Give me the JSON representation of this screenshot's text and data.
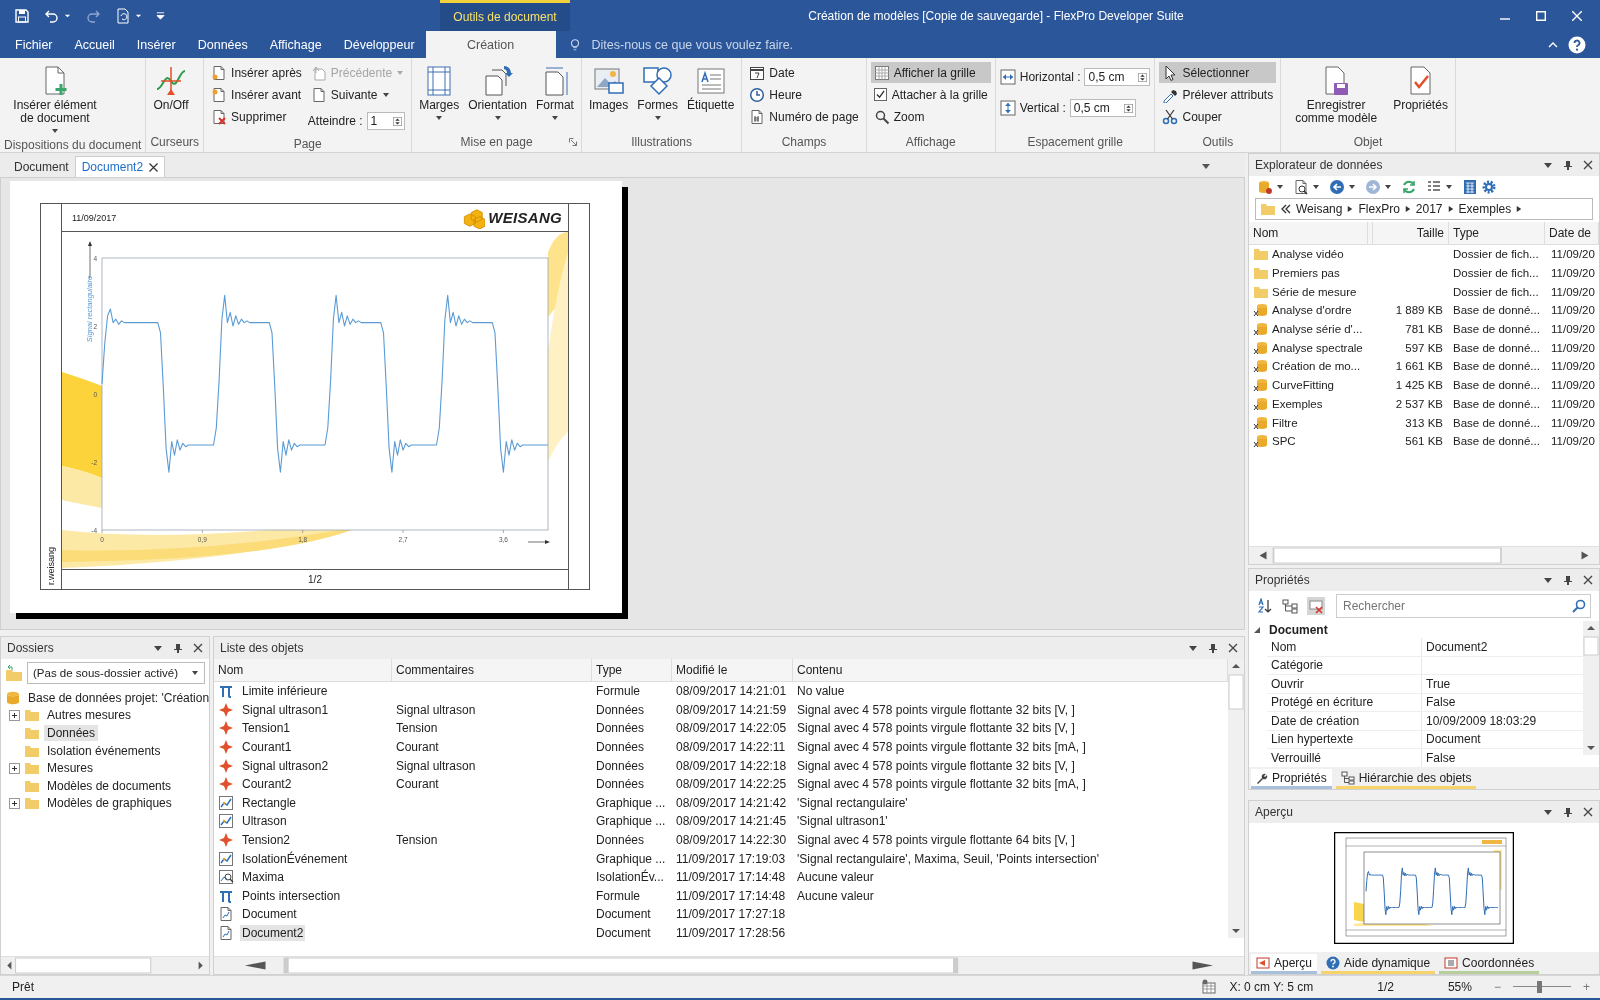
{
  "window": {
    "title": "Création de modèles [Copie de sauvegarde] - FlexPro Developer Suite"
  },
  "contextual_tab": "Outils de document",
  "ribbon": {
    "tabs": [
      {
        "label": "Fichier",
        "selected": false
      },
      {
        "label": "Accueil",
        "selected": false
      },
      {
        "label": "Insérer",
        "selected": false
      },
      {
        "label": "Données",
        "selected": false
      },
      {
        "label": "Affichage",
        "selected": false
      },
      {
        "label": "Développeur",
        "selected": false
      },
      {
        "label": "Création",
        "selected": true
      }
    ],
    "tell_me": {
      "placeholder": "Dites-nous ce que vous voulez faire."
    },
    "groups": [
      {
        "label": "Dispositions du document",
        "columns": [
          [
            {
              "kind": "large",
              "label": "Insérer élément de document",
              "dropdown": true
            }
          ]
        ]
      },
      {
        "label": "Curseurs",
        "columns": [
          [
            {
              "kind": "large",
              "label": "On/Off",
              "dropdown": false
            }
          ]
        ]
      },
      {
        "label": "Page",
        "columns": [
          [
            {
              "kind": "small",
              "label": "Insérer après",
              "dropdown": false,
              "disabled": false
            },
            {
              "kind": "small",
              "label": "Insérer avant",
              "dropdown": false,
              "disabled": false
            },
            {
              "kind": "small",
              "label": "Supprimer",
              "dropdown": false,
              "disabled": false
            }
          ],
          [
            {
              "kind": "small",
              "label": "Précédente",
              "dropdown": true,
              "disabled": true
            },
            {
              "kind": "small",
              "label": "Suivante",
              "dropdown": true,
              "disabled": false
            },
            {
              "kind": "spin",
              "label": "Atteindre :",
              "value": "1"
            }
          ]
        ]
      },
      {
        "label": "Mise en page",
        "launcher": true,
        "columns": [
          [
            {
              "kind": "large",
              "label": "Marges",
              "dropdown": true
            }
          ],
          [
            {
              "kind": "large",
              "label": "Orientation",
              "dropdown": true
            }
          ],
          [
            {
              "kind": "large",
              "label": "Format",
              "dropdown": true
            }
          ]
        ]
      },
      {
        "label": "Illustrations",
        "columns": [
          [
            {
              "kind": "large",
              "label": "Images",
              "dropdown": false
            }
          ],
          [
            {
              "kind": "large",
              "label": "Formes",
              "dropdown": true
            }
          ],
          [
            {
              "kind": "large",
              "label": "Étiquette",
              "dropdown": false
            }
          ]
        ]
      },
      {
        "label": "Champs",
        "columns": [
          [
            {
              "kind": "small",
              "label": "Date",
              "dropdown": false,
              "disabled": false
            },
            {
              "kind": "small",
              "label": "Heure",
              "dropdown": false,
              "disabled": false
            },
            {
              "kind": "small",
              "label": "Numéro de page",
              "dropdown": false,
              "disabled": false
            }
          ]
        ]
      },
      {
        "label": "Affichage",
        "columns": [
          [
            {
              "kind": "toggle",
              "label": "Afficher la grille",
              "selected": true
            },
            {
              "kind": "check",
              "label": "Attacher à la grille",
              "checked": true
            },
            {
              "kind": "small",
              "label": "Zoom",
              "dropdown": false,
              "disabled": false
            }
          ]
        ]
      },
      {
        "label": "Espacement grille",
        "columns": [
          [
            {
              "kind": "spin",
              "label": "Horizontal :",
              "value": "0,5 cm"
            },
            {
              "kind": "spin",
              "label": "Vertical :",
              "value": "0,5 cm"
            }
          ]
        ]
      },
      {
        "label": "Outils",
        "columns": [
          [
            {
              "kind": "toggle",
              "label": "Sélectionner",
              "selected": true
            },
            {
              "kind": "small",
              "label": "Prélever attributs",
              "dropdown": false,
              "disabled": false
            },
            {
              "kind": "small",
              "label": "Couper",
              "dropdown": false,
              "disabled": false
            }
          ]
        ]
      },
      {
        "label": "Objet",
        "columns": [
          [
            {
              "kind": "large",
              "label": "Enregistrer comme modèle",
              "dropdown": false
            }
          ],
          [
            {
              "kind": "large",
              "label": "Propriétés",
              "dropdown": false
            }
          ]
        ]
      }
    ]
  },
  "document": {
    "tabs": [
      {
        "label": "Document",
        "selected": false
      },
      {
        "label": "Document2",
        "selected": true
      }
    ],
    "page": {
      "date": "11/09/2017",
      "logo": "WEISANG",
      "author": "r.weisang",
      "page_number": "1/2",
      "chart_data": {
        "type": "line",
        "ylabel": "Signal rectangulaire",
        "xlim": [
          0,
          4
        ],
        "ylim": [
          -4,
          4
        ],
        "xticks": [
          0,
          {
            "value": 0.9,
            "label": "0,9"
          },
          {
            "value": 1.8,
            "label": "1,8"
          },
          {
            "value": 2.7,
            "label": "2,7"
          },
          {
            "value": 3.6,
            "label": "3,6"
          }
        ],
        "yticks": [
          -4,
          -2,
          0,
          2,
          4
        ],
        "x": [
          0,
          0.025,
          0.05,
          0.075,
          0.1,
          0.125,
          0.15,
          0.175,
          0.2,
          0.225,
          0.25,
          0.275,
          0.3,
          0.325,
          0.35,
          0.375,
          0.4,
          0.425,
          0.45,
          0.475,
          0.5,
          0.525,
          0.55,
          0.575,
          0.6,
          0.625,
          0.65,
          0.675,
          0.7,
          0.725,
          0.75,
          0.775,
          0.8,
          0.825,
          0.85,
          0.875,
          0.9,
          0.925,
          0.95,
          0.975,
          1,
          1.025,
          1.05,
          1.075,
          1.1,
          1.125,
          1.15,
          1.175,
          1.2,
          1.225,
          1.25,
          1.275,
          1.3,
          1.325,
          1.35,
          1.375,
          1.4,
          1.425,
          1.45,
          1.475,
          1.5,
          1.525,
          1.55,
          1.575,
          1.6,
          1.625,
          1.65,
          1.675,
          1.7,
          1.725,
          1.75,
          1.775,
          1.8,
          1.825,
          1.85,
          1.875,
          1.9,
          1.925,
          1.95,
          1.975,
          2,
          2.025,
          2.05,
          2.075,
          2.1,
          2.125,
          2.15,
          2.175,
          2.2,
          2.225,
          2.25,
          2.275,
          2.3,
          2.325,
          2.35,
          2.375,
          2.4,
          2.425,
          2.45,
          2.475,
          2.5,
          2.525,
          2.55,
          2.575,
          2.6,
          2.625,
          2.65,
          2.675,
          2.7,
          2.725,
          2.75,
          2.775,
          2.8,
          2.825,
          2.85,
          2.875,
          2.9,
          2.925,
          2.95,
          2.975,
          3,
          3.025,
          3.05,
          3.075,
          3.1,
          3.125,
          3.15,
          3.175,
          3.2,
          3.225,
          3.25,
          3.275,
          3.3,
          3.325,
          3.35,
          3.375,
          3.4,
          3.425,
          3.45,
          3.475,
          3.5,
          3.525,
          3.55,
          3.575,
          3.6,
          3.625,
          3.65,
          3.675,
          3.7,
          3.725,
          3.75,
          3.775,
          3.8,
          3.825,
          3.85,
          3.875,
          3.9,
          3.925,
          3.95,
          3.975,
          4
        ],
        "series": [
          {
            "color": "#5b9bd5",
            "values": [
              0.3,
              1.5,
              2.3,
              2.5,
              2.1,
              2.2,
              2.05,
              2.15,
              2.1,
              2.1,
              2.1,
              2.1,
              2.1,
              2.1,
              2.1,
              2.1,
              2.1,
              2.1,
              2.1,
              2.1,
              2.1,
              1.8,
              0.2,
              -1.6,
              -2.3,
              -1.4,
              -1.8,
              -1.35,
              -1.65,
              -1.45,
              -1.55,
              -1.5,
              -1.5,
              -1.5,
              -1.5,
              -1.5,
              -1.5,
              -1.5,
              -1.5,
              -1.5,
              -1.5,
              -1.0,
              0.4,
              2.2,
              2.9,
              2.1,
              2.4,
              2.0,
              2.3,
              2.05,
              2.2,
              2.1,
              2.15,
              2.1,
              2.1,
              2.1,
              2.1,
              2.1,
              2.1,
              2.1,
              2.1,
              1.8,
              0.2,
              -1.6,
              -2.3,
              -1.4,
              -1.8,
              -1.35,
              -1.65,
              -1.45,
              -1.55,
              -1.5,
              -1.5,
              -1.5,
              -1.5,
              -1.5,
              -1.5,
              -1.5,
              -1.5,
              -1.5,
              -1.5,
              -1.0,
              0.4,
              2.2,
              2.9,
              2.1,
              2.4,
              2.0,
              2.3,
              2.05,
              2.2,
              2.1,
              2.15,
              2.1,
              2.1,
              2.1,
              2.1,
              2.1,
              2.1,
              2.1,
              2.1,
              1.8,
              0.2,
              -1.6,
              -2.3,
              -1.4,
              -1.8,
              -1.35,
              -1.65,
              -1.45,
              -1.55,
              -1.5,
              -1.5,
              -1.5,
              -1.5,
              -1.5,
              -1.5,
              -1.5,
              -1.5,
              -1.5,
              -1.5,
              -1.0,
              0.4,
              2.2,
              2.9,
              2.1,
              2.4,
              2.0,
              2.3,
              2.05,
              2.2,
              2.1,
              2.15,
              2.1,
              2.1,
              2.1,
              2.1,
              2.1,
              2.1,
              2.1,
              2.1,
              1.8,
              0.2,
              -1.6,
              -2.3,
              -1.4,
              -1.8,
              -1.35,
              -1.65,
              -1.45,
              -1.55,
              -1.5,
              -1.5,
              -1.5,
              -1.5,
              -1.5,
              -1.5,
              -1.5,
              -1.5,
              -1.5,
              -1.5
            ]
          }
        ]
      }
    }
  },
  "folders": {
    "title": "Dossiers",
    "subfolder": {
      "value": "(Pas de sous-dossier activé)"
    },
    "tree": {
      "label": "Base de données projet: 'Création",
      "children": [
        {
          "label": "Autres mesures",
          "expanded": false,
          "selected": false
        },
        {
          "label": "Données",
          "selected": true
        },
        {
          "label": "Isolation événements",
          "selected": false
        },
        {
          "label": "Mesures",
          "expanded": false,
          "selected": false
        },
        {
          "label": "Modèles de documents",
          "selected": false
        },
        {
          "label": "Modèles de graphiques",
          "expanded": false,
          "selected": false
        }
      ]
    }
  },
  "objects": {
    "title": "Liste des objets",
    "columns": [
      "Nom",
      "Commentaires",
      "Type",
      "Modifié le",
      "Contenu"
    ],
    "rows": [
      {
        "kind": "formula",
        "name": "Limite inférieure",
        "type": "Formule",
        "modified": "08/09/2017 14:21:01",
        "content": "No value",
        "selected": false
      },
      {
        "kind": "data",
        "name": "Signal ultrason1",
        "comment": "Signal ultrason",
        "type": "Données",
        "modified": "08/09/2017 14:21:59",
        "content": "Signal avec 4 578 points virgule flottante 32 bits [V, ]",
        "selected": false
      },
      {
        "kind": "data",
        "name": "Tension1",
        "comment": "Tension",
        "type": "Données",
        "modified": "08/09/2017 14:22:05",
        "content": "Signal avec 4 578 points virgule flottante 32 bits [V, ]",
        "selected": false
      },
      {
        "kind": "data",
        "name": "Courant1",
        "comment": "Courant",
        "type": "Données",
        "modified": "08/09/2017 14:22:11",
        "content": "Signal avec 4 578 points virgule flottante 32 bits [mA, ]",
        "selected": false
      },
      {
        "kind": "data",
        "name": "Signal ultrason2",
        "comment": "Signal ultrason",
        "type": "Données",
        "modified": "08/09/2017 14:22:18",
        "content": "Signal avec 4 578 points virgule flottante 32 bits [V, ]",
        "selected": false
      },
      {
        "kind": "data",
        "name": "Courant2",
        "comment": "Courant",
        "type": "Données",
        "modified": "08/09/2017 14:22:25",
        "content": "Signal avec 4 578 points virgule flottante 32 bits [mA, ]",
        "selected": false
      },
      {
        "kind": "graph",
        "name": "Rectangle",
        "type": "Graphique ...",
        "modified": "08/09/2017 14:21:42",
        "content": "'Signal rectangulaire'",
        "selected": false
      },
      {
        "kind": "graph",
        "name": "Ultrason",
        "type": "Graphique ...",
        "modified": "08/09/2017 14:21:45",
        "content": "'Signal ultrason1'",
        "selected": false
      },
      {
        "kind": "data",
        "name": "Tension2",
        "comment": "Tension",
        "type": "Données",
        "modified": "08/09/2017 14:22:30",
        "content": "Signal avec 4 578 points virgule flottante 64 bits [V, ]",
        "selected": false
      },
      {
        "kind": "graph",
        "name": "IsolationÉvénement",
        "type": "Graphique ...",
        "modified": "11/09/2017 17:19:03",
        "content": "'Signal rectangulaire', Maxima, Seuil, 'Points intersection'",
        "selected": false
      },
      {
        "kind": "isolation",
        "name": "Maxima",
        "type": "IsolationÉv...",
        "modified": "11/09/2017 17:14:48",
        "content": "Aucune valeur",
        "selected": false
      },
      {
        "kind": "formula",
        "name": "Points intersection",
        "type": "Formule",
        "modified": "11/09/2017 17:14:48",
        "content": "Aucune valeur",
        "selected": false
      },
      {
        "kind": "document",
        "name": "Document",
        "type": "Document",
        "modified": "11/09/2017 17:27:18",
        "selected": false
      },
      {
        "kind": "document",
        "name": "Document2",
        "type": "Document",
        "modified": "11/09/2017 17:28:56",
        "selected": true
      }
    ]
  },
  "explorer": {
    "title": "Explorateur de données",
    "breadcrumb": [
      "Weisang",
      "FlexPro",
      "2017",
      "Exemples"
    ],
    "columns": [
      "Nom",
      "Taille",
      "Type",
      "Date de"
    ],
    "rows": [
      {
        "kind": "folder",
        "name": "Analyse vidéo",
        "type": "Dossier de fich...",
        "date": "11/09/20"
      },
      {
        "kind": "folder",
        "name": "Premiers pas",
        "type": "Dossier de fich...",
        "date": "11/09/20"
      },
      {
        "kind": "folder",
        "name": "Série de mesure",
        "type": "Dossier de fich...",
        "date": "11/09/20"
      },
      {
        "kind": "database",
        "name": "Analyse d'ordre",
        "size": "1 889 KB",
        "type": "Base de donné...",
        "date": "11/09/20"
      },
      {
        "kind": "database",
        "name": "Analyse série d'...",
        "size": "781 KB",
        "type": "Base de donné...",
        "date": "11/09/20"
      },
      {
        "kind": "database",
        "name": "Analyse spectrale",
        "size": "597 KB",
        "type": "Base de donné...",
        "date": "11/09/20"
      },
      {
        "kind": "database",
        "name": "Création de mo...",
        "size": "1 661 KB",
        "type": "Base de donné...",
        "date": "11/09/20"
      },
      {
        "kind": "database",
        "name": "CurveFitting",
        "size": "1 425 KB",
        "type": "Base de donné...",
        "date": "11/09/20"
      },
      {
        "kind": "database",
        "name": "Exemples",
        "size": "2 537 KB",
        "type": "Base de donné...",
        "date": "11/09/20"
      },
      {
        "kind": "database",
        "name": "Filtre",
        "size": "313 KB",
        "type": "Base de donné...",
        "date": "11/09/20"
      },
      {
        "kind": "database",
        "name": "SPC",
        "size": "561 KB",
        "type": "Base de donné...",
        "date": "11/09/20"
      }
    ]
  },
  "properties": {
    "title": "Propriétés",
    "search": {
      "placeholder": "Rechercher"
    },
    "category": {
      "label": "Document",
      "expanded": true
    },
    "rows": [
      {
        "name": "Nom",
        "value": "Document2"
      },
      {
        "name": "Catégorie"
      },
      {
        "name": "Ouvrir",
        "value": "True"
      },
      {
        "name": "Protégé en écriture",
        "value": "False"
      },
      {
        "name": "Date de création",
        "value": "10/09/2009 18:03:29"
      },
      {
        "name": "Lien hypertexte",
        "value": "Document"
      },
      {
        "name": "Verrouillé",
        "value": "False"
      }
    ],
    "tabs": [
      {
        "label": "Propriétés",
        "selected": true,
        "color": "#a9c0dd"
      },
      {
        "label": "Hiérarchie des objets",
        "selected": false,
        "color": "#f6d46b"
      }
    ]
  },
  "preview": {
    "title": "Aperçu",
    "tabs": [
      {
        "label": "Aperçu",
        "selected": true,
        "color": "#a9c0dd"
      },
      {
        "label": "Aide dynamique",
        "selected": false,
        "color": "#f6d46b"
      },
      {
        "label": "Coordonnées",
        "selected": false,
        "color": "#b7cd9c"
      }
    ]
  },
  "status_bar": {
    "text": "Prêt",
    "coords": "X: 0 cm Y: 5 cm",
    "page": "1/2",
    "zoom": "55%",
    "minus": "−",
    "plus": "+",
    "zoom_slider": {
      "level": 0.45
    }
  }
}
